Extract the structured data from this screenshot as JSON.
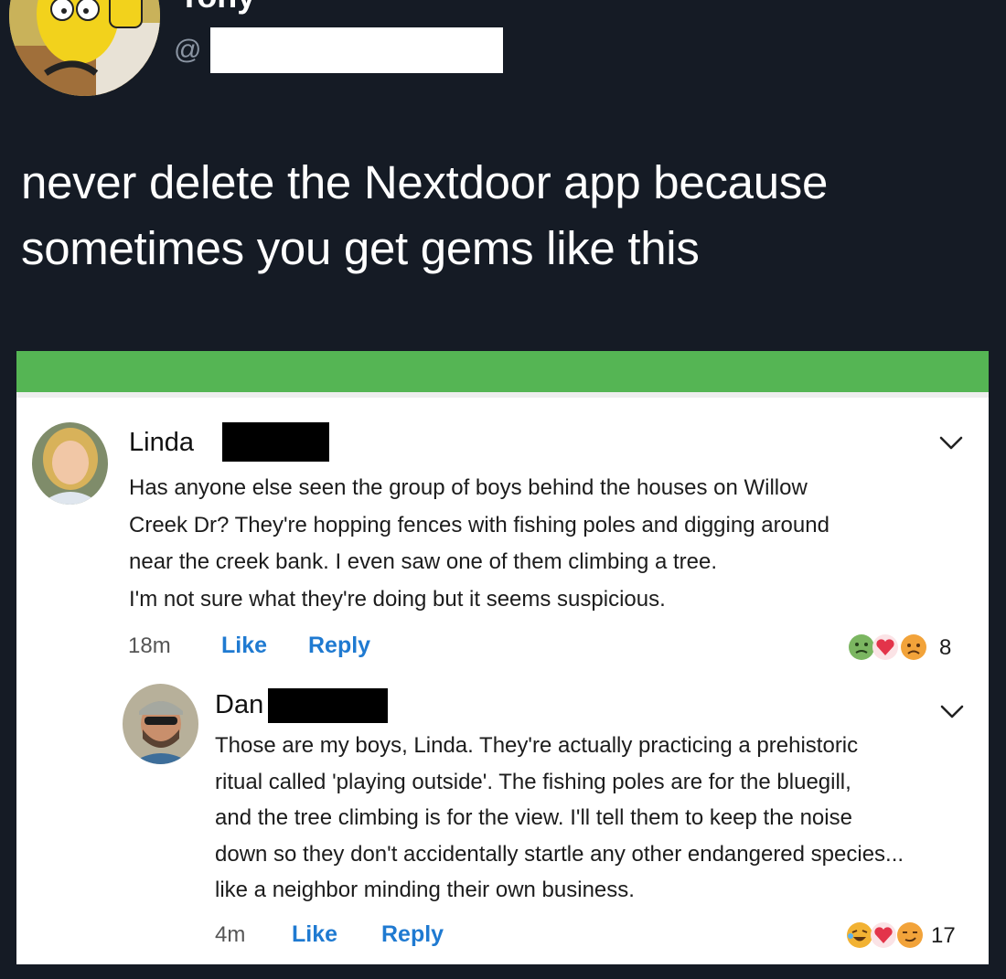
{
  "tweet": {
    "display_name": "Tony",
    "at_symbol": "@",
    "text": "never delete the Nextdoor app because\nsometimes you get gems like this"
  },
  "colors": {
    "background": "#151b25",
    "nextdoor_green": "#55b554",
    "link_blue": "#1f7ad1"
  },
  "comments": [
    {
      "author": "Linda",
      "avatar_icon": "profile-photo-icon",
      "body": "Has anyone else seen the group of boys behind the houses on Willow\nCreek Dr? They're hopping fences with fishing poles and digging around\nnear the creek bank. I even saw one of them climbing a tree.\nI'm not sure what they're doing but it seems suspicious.",
      "time": "18m",
      "like_label": "Like",
      "reply_label": "Reply",
      "reactions": [
        "sick-emoji-icon",
        "heart-icon",
        "sad-emoji-icon"
      ],
      "reaction_count": "8"
    },
    {
      "author": "Dan",
      "avatar_icon": "profile-photo-icon",
      "body": "Those are my boys, Linda. They're actually practicing a prehistoric\nritual called 'playing outside'. The fishing poles are for the bluegill,\nand the tree climbing is for the view. I'll tell them to keep the noise\ndown so they don't accidentally startle any other endangered species...\nlike a neighbor minding their own business.",
      "time": "4m",
      "like_label": "Like",
      "reply_label": "Reply",
      "reactions": [
        "laughing-crying-emoji-icon",
        "heart-icon",
        "smirk-emoji-icon"
      ],
      "reaction_count": "17"
    }
  ]
}
